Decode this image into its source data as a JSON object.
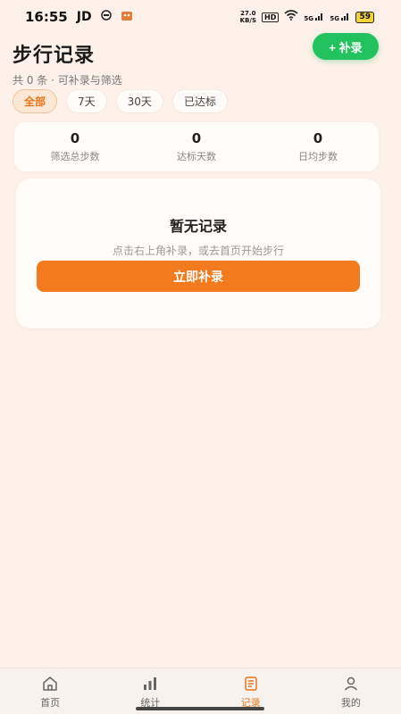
{
  "status_bar": {
    "time": "16:55",
    "carrier": "JD",
    "net_speed_value": "27.0",
    "net_speed_unit": "KB/S",
    "hd": "HD",
    "signal_1": "5G",
    "signal_2": "5G",
    "battery": "59"
  },
  "header": {
    "title": "步行记录",
    "subtitle": "共 0 条 · 可补录与筛选",
    "add_label": "+ 补录"
  },
  "filters": [
    "全部",
    "7天",
    "30天",
    "已达标"
  ],
  "stats": [
    {
      "value": "0",
      "label": "筛选总步数"
    },
    {
      "value": "0",
      "label": "达标天数"
    },
    {
      "value": "0",
      "label": "日均步数"
    }
  ],
  "empty": {
    "title": "暂无记录",
    "description": "点击右上角补录，或去首页开始步行",
    "button_label": "立即补录"
  },
  "tabs": [
    {
      "label": "首页",
      "icon": "home-icon"
    },
    {
      "label": "统计",
      "icon": "bar-chart-icon"
    },
    {
      "label": "记录",
      "icon": "document-icon"
    },
    {
      "label": "我的",
      "icon": "user-icon"
    }
  ],
  "colors": {
    "accent": "#f37a1f",
    "green": "#22c35e",
    "background": "#fdf1e9"
  }
}
